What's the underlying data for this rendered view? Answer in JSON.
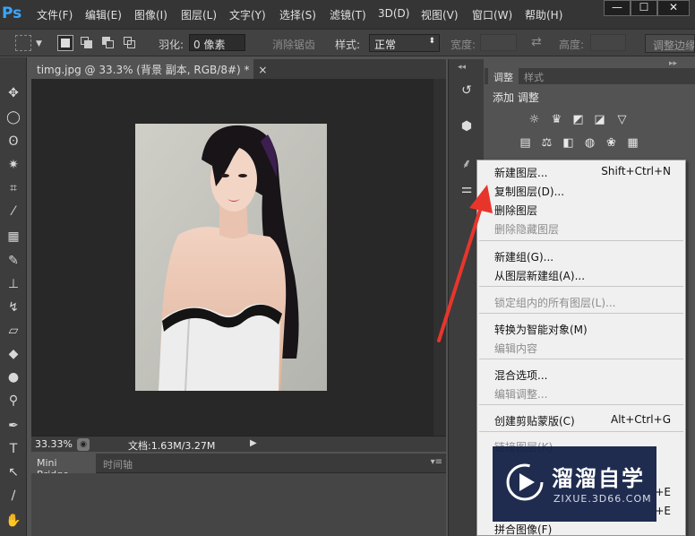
{
  "menubar": {
    "logo": "Ps",
    "items": [
      "文件(F)",
      "编辑(E)",
      "图像(I)",
      "图层(L)",
      "文字(Y)",
      "选择(S)",
      "滤镜(T)",
      "3D(D)",
      "视图(V)",
      "窗口(W)",
      "帮助(H)"
    ],
    "window_buttons": [
      "—",
      "☐",
      "✕"
    ]
  },
  "options": {
    "feather_label": "羽化:",
    "feather_value": "0 像素",
    "antialias_label": "消除锯齿",
    "style_label": "样式:",
    "style_value": "正常",
    "width_label": "宽度:",
    "height_label": "高度:",
    "refine_edge_button": "调整边缘"
  },
  "document": {
    "tab_title": "timg.jpg @ 33.3% (背景 副本, RGB/8#) *",
    "tab_close": "×",
    "zoom": "33.33%",
    "doc_size": "文档:1.63M/3.27M"
  },
  "bridge": {
    "tab_active": "Mini Bridge",
    "tab_inactive": "时间轴"
  },
  "adjustments": {
    "tab_active": "调整",
    "tab_inactive": "样式",
    "heading": "添加 调整"
  },
  "context_menu": {
    "items": [
      {
        "label": "新建图层...",
        "shortcut": "Shift+Ctrl+N",
        "disabled": false
      },
      {
        "label": "复制图层(D)...",
        "shortcut": "",
        "disabled": false
      },
      {
        "label": "删除图层",
        "shortcut": "",
        "disabled": false
      },
      {
        "label": "删除隐藏图层",
        "shortcut": "",
        "disabled": true
      },
      {
        "label": "新建组(G)...",
        "shortcut": "",
        "disabled": false
      },
      {
        "label": "从图层新建组(A)...",
        "shortcut": "",
        "disabled": false
      },
      {
        "label": "锁定组内的所有图层(L)...",
        "shortcut": "",
        "disabled": true
      },
      {
        "label": "转换为智能对象(M)",
        "shortcut": "",
        "disabled": false
      },
      {
        "label": "编辑内容",
        "shortcut": "",
        "disabled": true
      },
      {
        "label": "混合选项...",
        "shortcut": "",
        "disabled": false
      },
      {
        "label": "编辑调整...",
        "shortcut": "",
        "disabled": true
      },
      {
        "label": "创建剪贴蒙版(C)",
        "shortcut": "Alt+Ctrl+G",
        "disabled": false
      },
      {
        "label": "链接图层(K)",
        "shortcut": "",
        "disabled": true
      },
      {
        "label": "",
        "shortcut": "+E",
        "disabled": false
      },
      {
        "label": "",
        "shortcut": "+E",
        "disabled": false
      },
      {
        "label": "拼合图像(F)",
        "shortcut": "",
        "disabled": false
      }
    ]
  },
  "watermark": {
    "title": "溜溜自学",
    "url": "ZIXUE.3D66.COM"
  },
  "colors": {
    "arrow": "#e8352c",
    "ps_blue": "#3aa5ff",
    "menu_bg": "#f0f0f0"
  }
}
